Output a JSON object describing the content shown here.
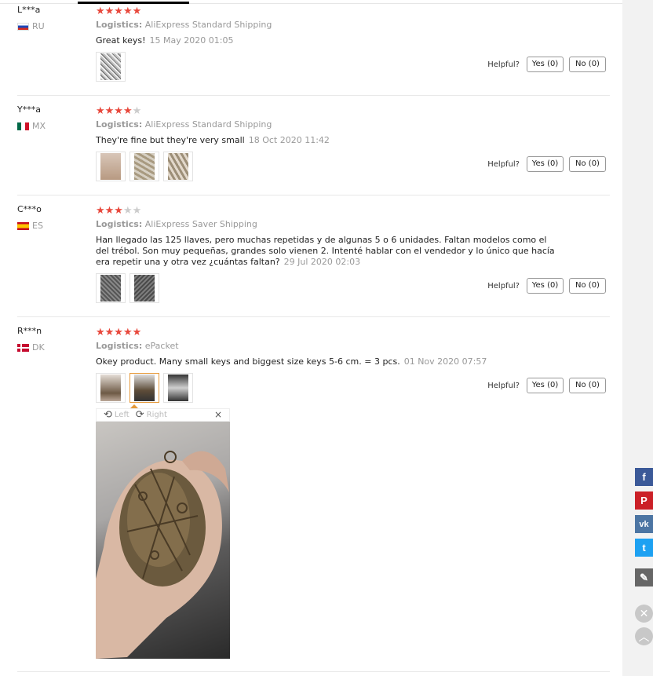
{
  "colors": {
    "star_on": "#e8483c",
    "star_off": "#cccccc",
    "accent": "#e69a3a"
  },
  "helpful_label": "Helpful?",
  "reviews": [
    {
      "user": "L***a",
      "country": "RU",
      "rating": 5,
      "logistics_label": "Logistics:",
      "logistics": "AliExpress Standard Shipping",
      "comment": "Great keys!",
      "date": "15 May 2020 01:05",
      "photos": 1,
      "yes": "Yes (0)",
      "no": "No (0)"
    },
    {
      "user": "Y***a",
      "country": "MX",
      "rating": 4,
      "logistics_label": "Logistics:",
      "logistics": "AliExpress Standard Shipping",
      "comment": "They're fine but they're very small",
      "date": "18 Oct 2020 11:42",
      "photos": 3,
      "yes": "Yes (0)",
      "no": "No (0)"
    },
    {
      "user": "C***o",
      "country": "ES",
      "rating": 3,
      "logistics_label": "Logistics:",
      "logistics": "AliExpress Saver Shipping",
      "comment": "Han llegado las 125 llaves, pero muchas repetidas y de algunas 5 o 6 unidades. Faltan modelos como el del trébol. Son muy pequeñas, grandes solo vienen 2. Intenté hablar con el vendedor y lo único que hacía era repetir una y otra vez ¿cuántas faltan?",
      "date": "29 Jul 2020 02:03",
      "photos": 2,
      "yes": "Yes (0)",
      "no": "No (0)"
    },
    {
      "user": "R***n",
      "country": "DK",
      "rating": 5,
      "logistics_label": "Logistics:",
      "logistics": "ePacket",
      "comment": "Okey product. Many small keys and biggest size keys 5-6 cm. = 3 pcs.",
      "date": "01 Nov 2020 07:57",
      "photos": 3,
      "yes": "Yes (0)",
      "no": "No (0)"
    }
  ],
  "viewer": {
    "rotate_left": "Left",
    "rotate_right": "Right",
    "close": "×"
  },
  "share_icons": [
    "facebook-icon",
    "pinterest-icon",
    "vk-icon",
    "twitter-icon",
    "edit-icon",
    "close-icon",
    "back-to-top-icon"
  ]
}
